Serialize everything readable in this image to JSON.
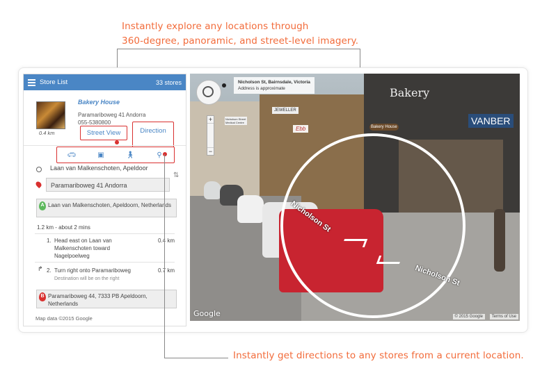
{
  "callouts": {
    "top_line1": "Instantly explore any locations through",
    "top_line2": "360-degree, panoramic, and street-level imagery.",
    "bottom": "Instantly get directions to any stores from a current location."
  },
  "sidebar": {
    "title": "Store List",
    "count": "33 stores",
    "store": {
      "name": "Bakery House",
      "address": "Paramariboweg 41 Andorra",
      "phone": "055-5380800",
      "distance": "0.4 km",
      "street_view_label": "Street View",
      "direction_label": "Direction"
    },
    "travel_modes": [
      "car-icon",
      "transit-icon",
      "walk-icon",
      "bicycle-icon"
    ],
    "route": {
      "from": "Laan van Malkenschoten, Apeldoor",
      "to": "Paramariboweg 41  Andorra",
      "start_point": "Laan van Malkenschoten, Apeldoorn, Netherlands",
      "summary": "1.2 km - about 2 mins",
      "steps": [
        {
          "num": "1.",
          "text": "Head east on Laan van Malkenschoten toward Nagelpoelweg",
          "dist": "0.4 km",
          "note": ""
        },
        {
          "num": "2.",
          "text": "Turn right onto Paramariboweg",
          "dist": "0.7 km",
          "note": "Destination will be on the right"
        }
      ],
      "end_point": "Paramariboweg 44, 7333 PB Apeldoorn, Netherlands",
      "start_marker": "A",
      "end_marker": "B"
    },
    "map_data": "Map data ©2015 Google"
  },
  "streetview": {
    "location": "Nicholson St, Bairnsdale, Victoria",
    "approx": "Address is approximate",
    "street_label_1": "Nicholson St",
    "street_label_2": "Nicholson St",
    "google": "Google",
    "copyright": "© 2015 Google",
    "terms": "Terms of Use",
    "shop_signs": [
      "Bakery",
      "VANBER",
      "JEWELLER",
      "Ebb",
      "Bakery House",
      "Nicholson Street Medical Centre"
    ]
  },
  "colors": {
    "accent": "#f26b3a",
    "header_blue": "#4a86c5",
    "highlight_red": "#d9302f"
  }
}
